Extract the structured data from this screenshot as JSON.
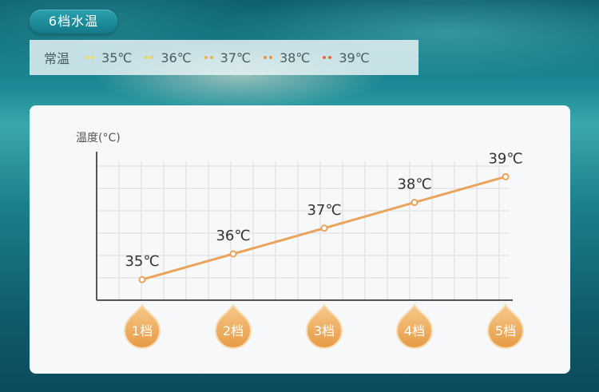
{
  "header": {
    "title": "6档水温"
  },
  "legend": {
    "label": "常温",
    "items": [
      {
        "label": "35℃",
        "color": "#f2dd5a"
      },
      {
        "label": "36℃",
        "color": "#f0cf4e"
      },
      {
        "label": "37℃",
        "color": "#f0b24a"
      },
      {
        "label": "38℃",
        "color": "#ec8f3f"
      },
      {
        "label": "39℃",
        "color": "#e86a35"
      }
    ]
  },
  "chart_data": {
    "type": "line",
    "ylabel": "温度(°C)",
    "xlabel": "",
    "categories": [
      "1档",
      "2档",
      "3档",
      "4档",
      "5档"
    ],
    "values": [
      35,
      36,
      37,
      38,
      39
    ],
    "data_labels": [
      "35℃",
      "36℃",
      "37℃",
      "38℃",
      "39℃"
    ],
    "ylim": [
      34.2,
      39.6
    ],
    "grid": true,
    "line_color": "#e9a35b"
  }
}
